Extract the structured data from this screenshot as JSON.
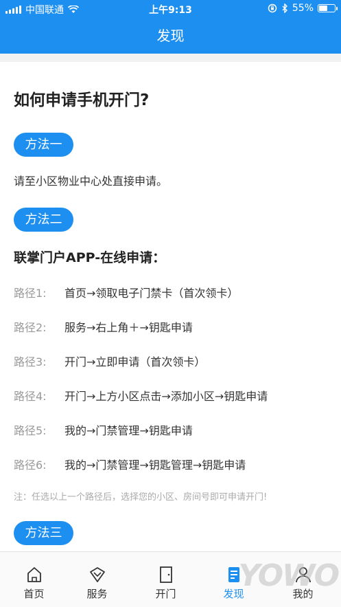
{
  "status_bar": {
    "carrier": "中国联通",
    "time": "上午9:13",
    "battery": "55%",
    "battery_level": 0.55
  },
  "nav": {
    "title": "发现"
  },
  "article": {
    "title": "如何申请手机开门?",
    "method1": {
      "label": "方法一",
      "text": "请至小区物业中心处直接申请。"
    },
    "method2": {
      "label": "方法二",
      "subhead": "联掌门户APP-在线申请：",
      "paths": [
        {
          "label": "路径1:",
          "value": "首页→领取电子门禁卡（首次领卡）"
        },
        {
          "label": "路径2:",
          "value": "服务→右上角＋→钥匙申请"
        },
        {
          "label": "路径3:",
          "value": "开门→立即申请（首次领卡）"
        },
        {
          "label": "路径4:",
          "value": "开门→上方小区点击→添加小区→钥匙申请"
        },
        {
          "label": "路径5:",
          "value": "我的→门禁管理→钥匙申请"
        },
        {
          "label": "路径6:",
          "value": "我的→门禁管理→钥匙管理→钥匙申请"
        }
      ],
      "note": "注：任选以上一个路径后，选择您的小区、房间号即可申请开门!"
    },
    "method3": {
      "label": "方法三"
    }
  },
  "tabbar": {
    "items": [
      {
        "label": "首页",
        "icon": "home-icon"
      },
      {
        "label": "服务",
        "icon": "diamond-icon"
      },
      {
        "label": "开门",
        "icon": "door-icon"
      },
      {
        "label": "发现",
        "icon": "discover-icon",
        "active": true
      },
      {
        "label": "我的",
        "icon": "person-icon"
      }
    ],
    "active_color": "#1d8ff0"
  },
  "colors": {
    "accent": "#1d8ff0"
  }
}
